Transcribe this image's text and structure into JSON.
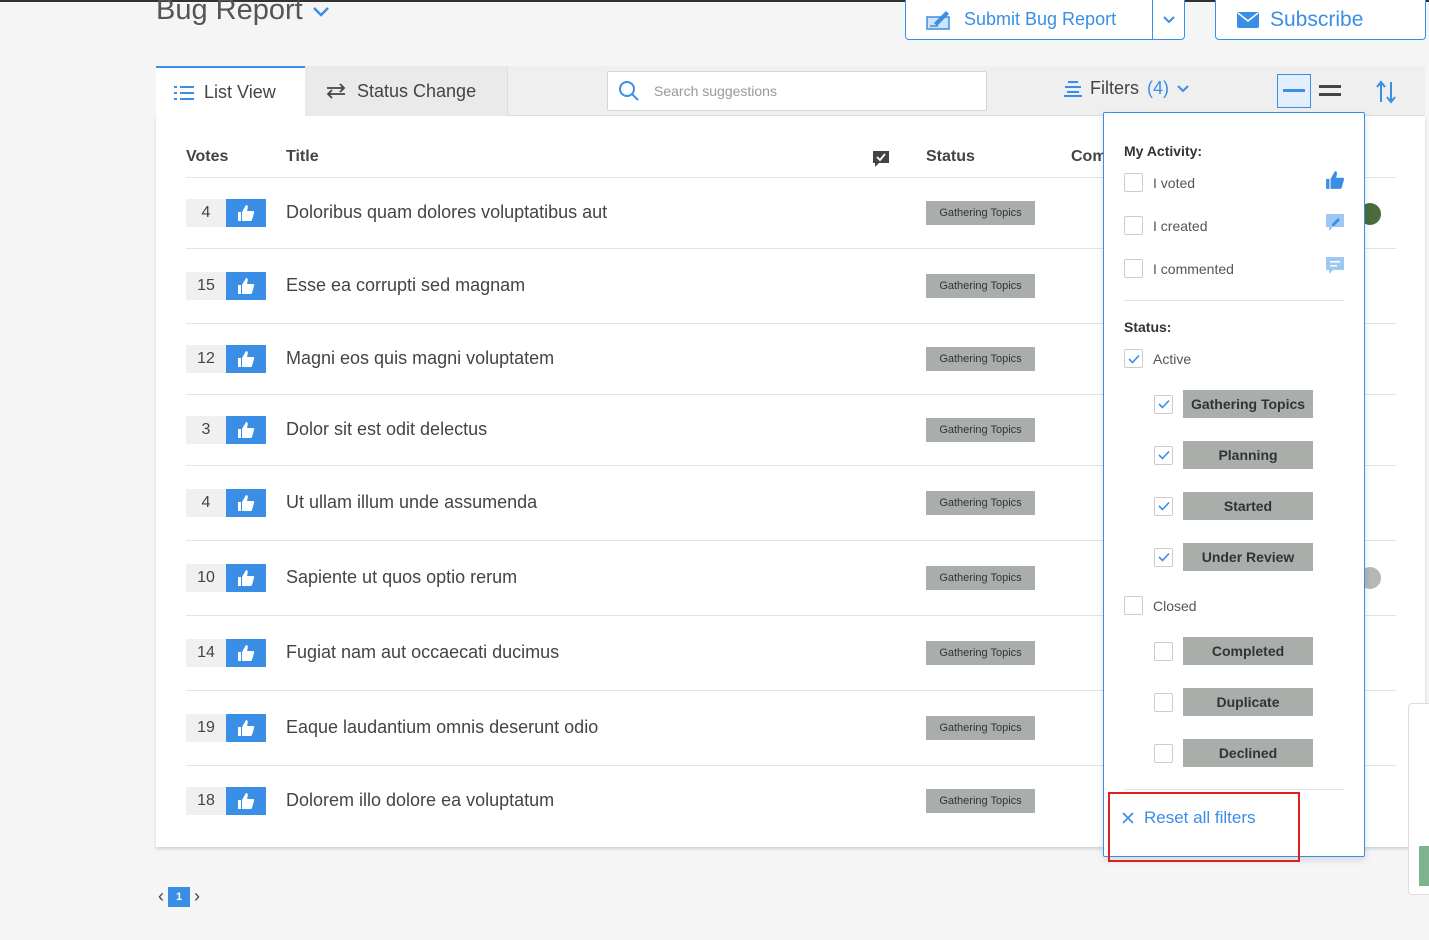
{
  "header": {
    "title": "Bug Report",
    "submit_label": "Submit Bug Report",
    "subscribe_label": "Subscribe"
  },
  "toolbar": {
    "tabs": [
      {
        "label": "List View",
        "icon": "list-icon",
        "active": true
      },
      {
        "label": "Status Change",
        "icon": "swap-icon",
        "active": false
      }
    ],
    "search_placeholder": "Search suggestions",
    "filters_label": "Filters",
    "filters_count": "(4)"
  },
  "table": {
    "columns": [
      "Votes",
      "Title",
      "Status",
      "Com"
    ],
    "rows": [
      {
        "votes": "4",
        "title": "Doloribus quam dolores voluptatibus aut",
        "status": "Gathering Topics"
      },
      {
        "votes": "15",
        "title": "Esse ea corrupti sed magnam",
        "status": "Gathering Topics"
      },
      {
        "votes": "12",
        "title": "Magni eos quis magni voluptatem",
        "status": "Gathering Topics"
      },
      {
        "votes": "3",
        "title": "Dolor sit est odit delectus",
        "status": "Gathering Topics"
      },
      {
        "votes": "4",
        "title": "Ut ullam illum unde assumenda",
        "status": "Gathering Topics"
      },
      {
        "votes": "10",
        "title": "Sapiente ut quos optio rerum",
        "status": "Gathering Topics"
      },
      {
        "votes": "14",
        "title": "Fugiat nam aut occaecati ducimus",
        "status": "Gathering Topics"
      },
      {
        "votes": "19",
        "title": "Eaque laudantium omnis deserunt odio",
        "status": "Gathering Topics"
      },
      {
        "votes": "18",
        "title": "Dolorem illo dolore ea voluptatum",
        "status": "Gathering Topics"
      }
    ]
  },
  "pagination": {
    "current": "1"
  },
  "filters_dropdown": {
    "my_activity_heading": "My Activity:",
    "activity": [
      {
        "label": "I voted",
        "checked": false,
        "icon": "thumbs-up-icon"
      },
      {
        "label": "I created",
        "checked": false,
        "icon": "edit-bubble-icon"
      },
      {
        "label": "I commented",
        "checked": false,
        "icon": "comment-icon"
      }
    ],
    "status_heading": "Status:",
    "active_label": "Active",
    "active_checked": true,
    "active_statuses": [
      {
        "label": "Gathering Topics",
        "checked": true
      },
      {
        "label": "Planning",
        "checked": true
      },
      {
        "label": "Started",
        "checked": true
      },
      {
        "label": "Under Review",
        "checked": true
      }
    ],
    "closed_label": "Closed",
    "closed_checked": false,
    "closed_statuses": [
      {
        "label": "Completed",
        "checked": false
      },
      {
        "label": "Duplicate",
        "checked": false
      },
      {
        "label": "Declined",
        "checked": false
      }
    ],
    "reset_label": "Reset all filters"
  },
  "colors": {
    "accent": "#3a8ee6",
    "badge_bg": "#aaaeab",
    "highlight": "#e02020"
  }
}
